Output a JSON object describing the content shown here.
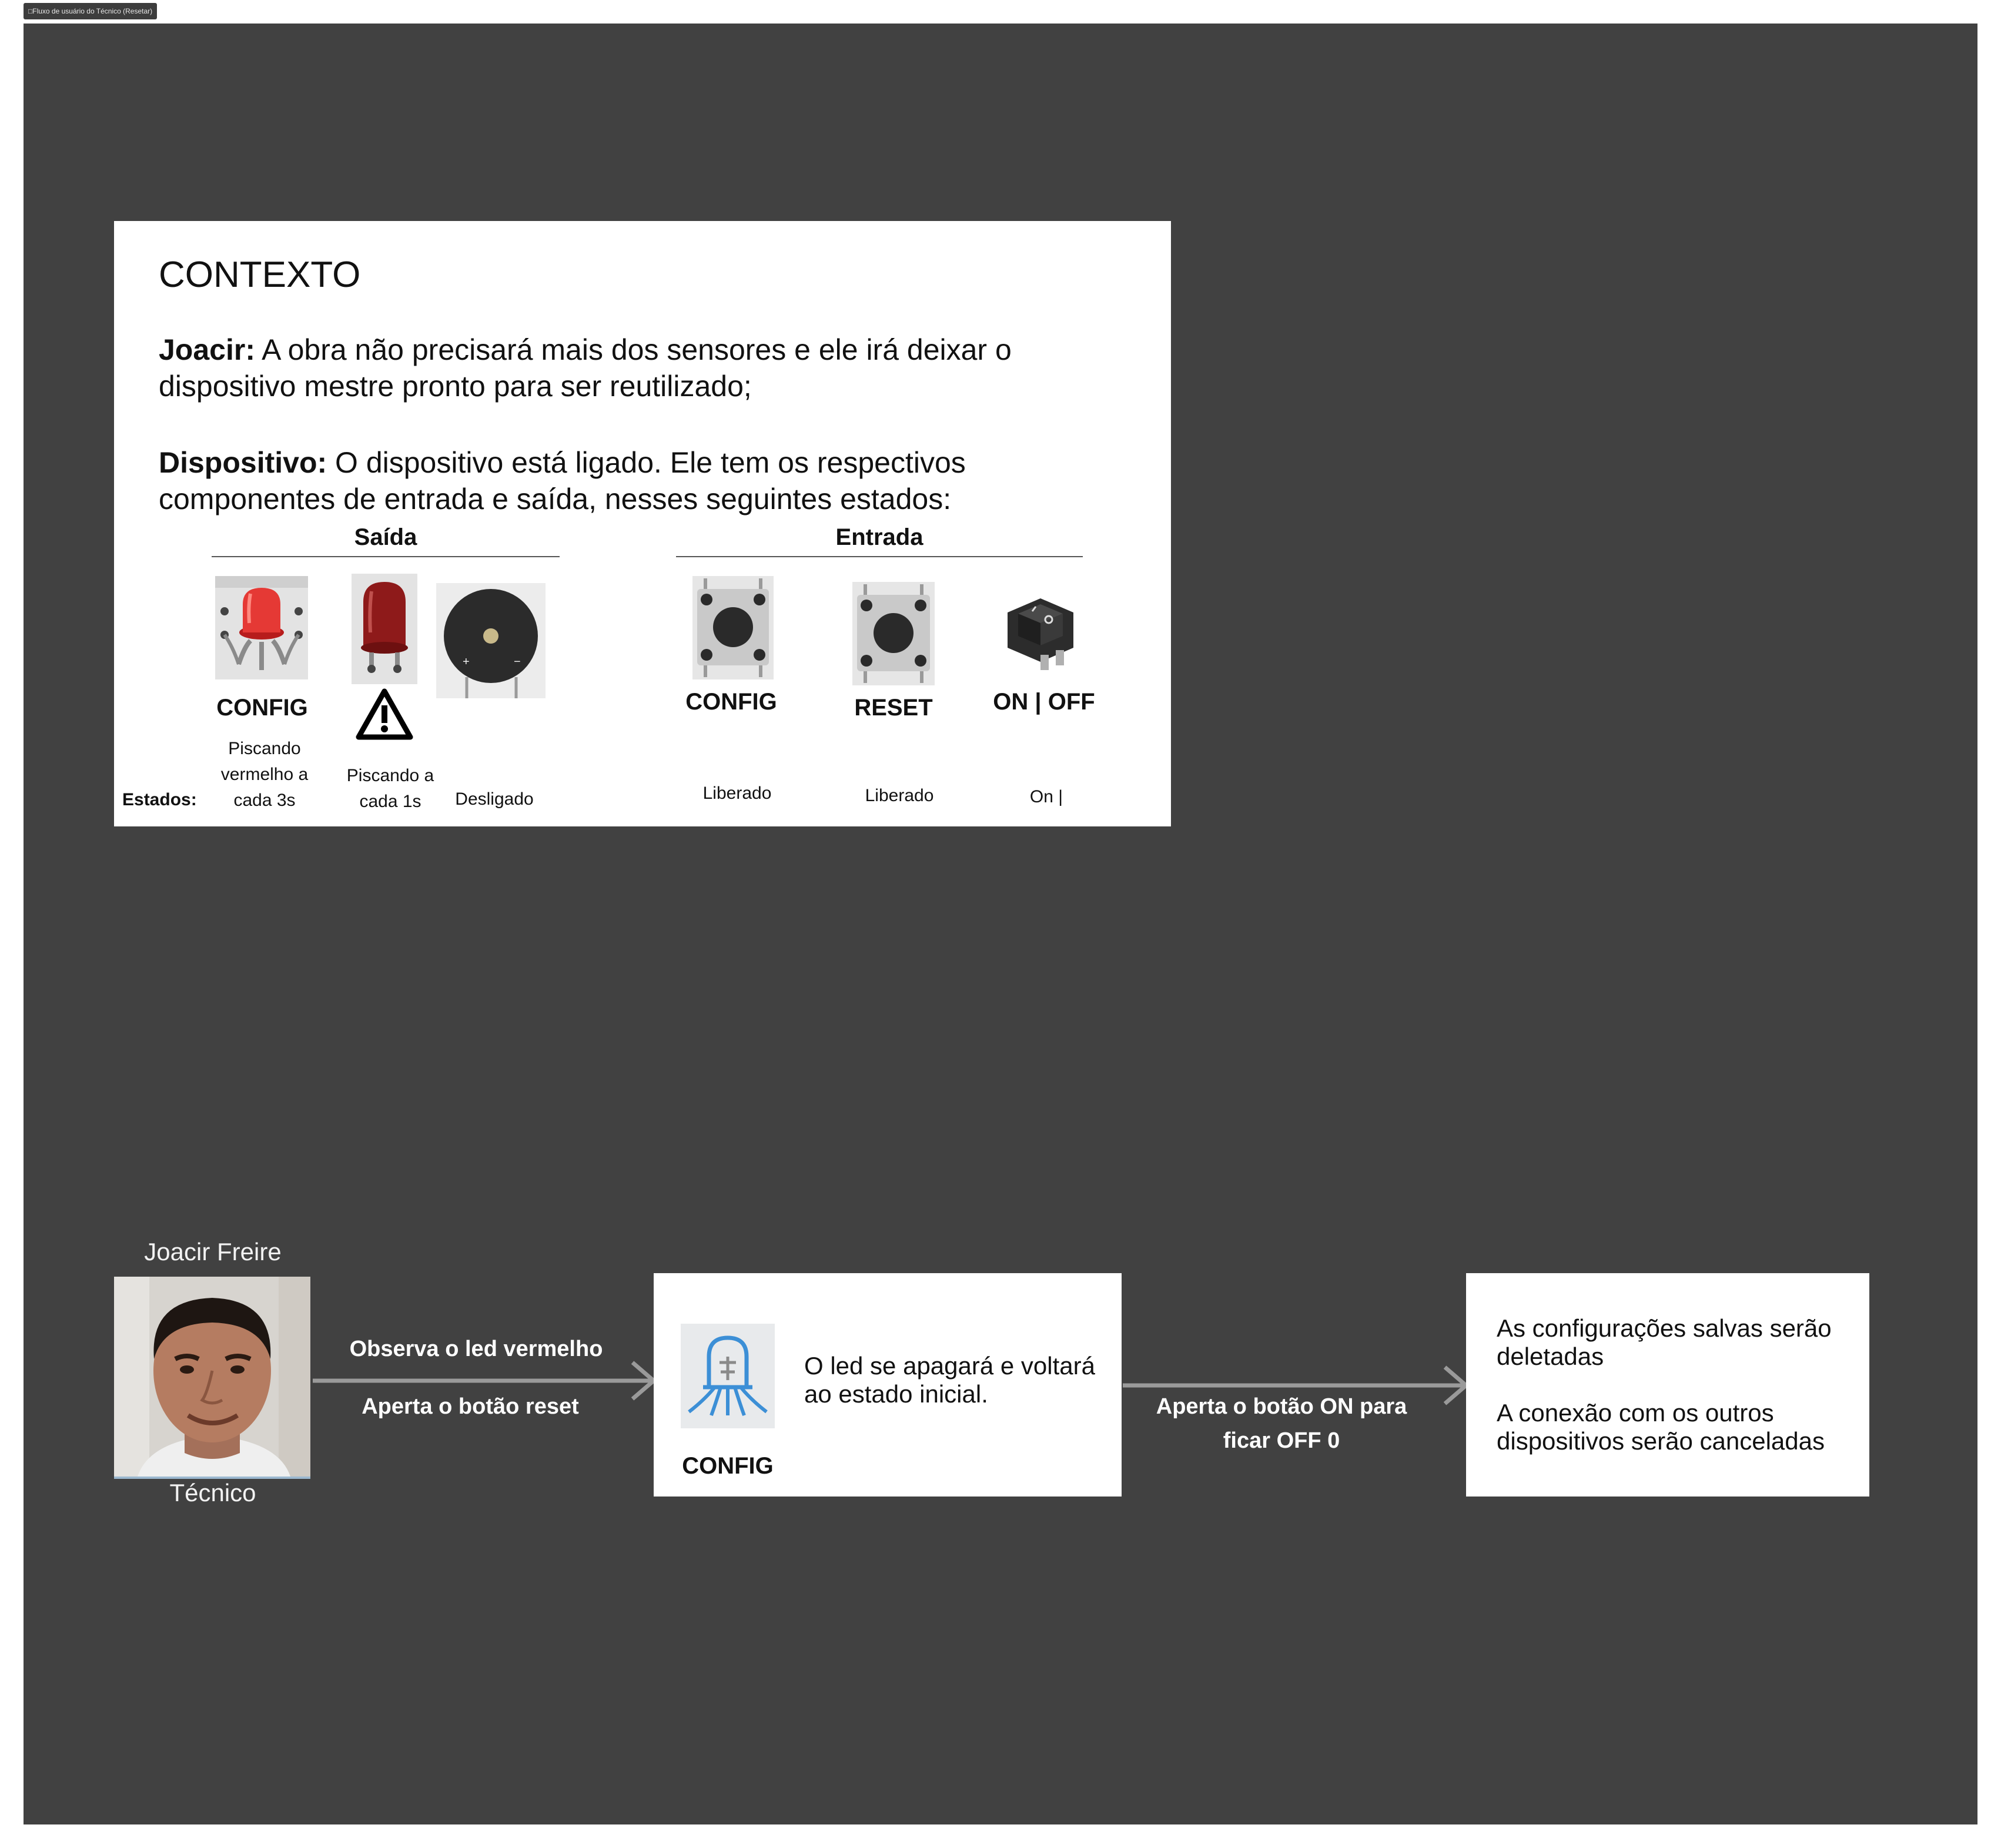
{
  "frame": {
    "tab_title": "□Fluxo de usuário do Técnico (Resetar)"
  },
  "context": {
    "title": "CONTEXTO",
    "joacir_label": "Joacir:",
    "joacir_text": " A obra não precisará mais dos sensores e ele irá deixar o dispositivo mestre pronto para ser reutilizado;",
    "device_label": "Dispositivo:",
    "device_text": " O dispositivo está ligado. Ele tem os respectivos componentes de entrada e saída, nesses seguintes estados:",
    "output_heading": "Saída",
    "input_heading": "Entrada",
    "states_label": "Estados:",
    "outputs": [
      {
        "label": "CONFIG",
        "state": "Piscando vermelho a cada 3s",
        "icon": "red-led-module-icon"
      },
      {
        "label": "",
        "state": "Piscando a cada 1s",
        "icon": "red-led-warning-icon"
      },
      {
        "label": "",
        "state": "Desligado",
        "icon": "buzzer-icon"
      }
    ],
    "inputs": [
      {
        "label": "CONFIG",
        "state": "Liberado",
        "icon": "push-button-icon"
      },
      {
        "label": "RESET",
        "state": "Liberado",
        "icon": "push-button-icon"
      },
      {
        "label": "ON | OFF",
        "state": "On |",
        "icon": "rocker-switch-icon"
      }
    ]
  },
  "flow": {
    "persona": {
      "name": "Joacir Freire",
      "role": "Técnico"
    },
    "edge1": {
      "top": "Observa o led vermelho",
      "bottom": "Aperta o botão reset"
    },
    "step1": {
      "icon_label": "CONFIG",
      "text": "O led se apagará e voltará ao estado inicial."
    },
    "edge2": {
      "label": "Aperta o botão ON para ficar OFF 0"
    },
    "step2": {
      "line1": "As configurações salvas serão deletadas",
      "line2": "A conexão com os outros dispositivos serão canceladas"
    }
  },
  "colors": {
    "canvas": "#414141",
    "card": "#ffffff",
    "arrow": "#9a9a9a",
    "led_red": "#e53935",
    "led_dark_red": "#8e1a1a",
    "icon_blue": "#3c8fd6"
  }
}
